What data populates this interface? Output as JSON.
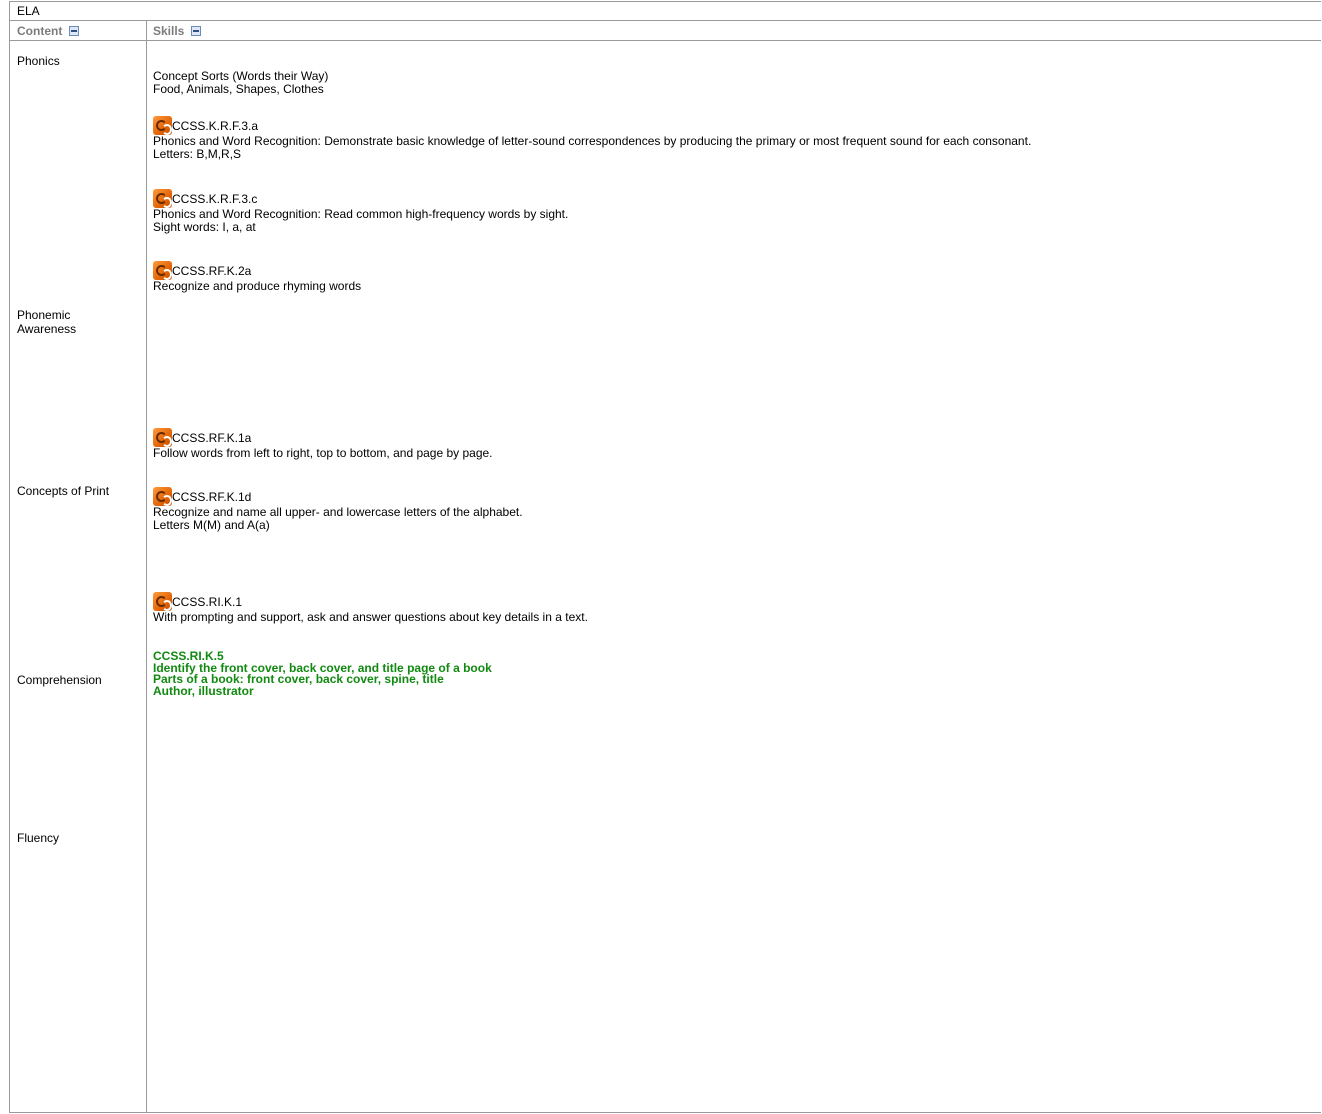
{
  "table": {
    "title": "ELA",
    "headers": {
      "content": "Content",
      "skills": "Skills"
    },
    "content_labels": [
      [
        "Phonics"
      ],
      [
        "Phonemic",
        "Awareness"
      ],
      [
        "Concepts of Print"
      ],
      [
        "Comprehension"
      ],
      [
        "Fluency"
      ]
    ],
    "skills": {
      "concept_sorts": [
        "Concept Sorts (Words their Way)",
        "Food, Animals, Shapes, Clothes"
      ],
      "std1": {
        "code": "CCSS.K.R.F.3.a",
        "lines": [
          "Phonics and Word Recognition: Demonstrate basic knowledge of letter-sound correspondences by producing the primary or most frequent sound for each consonant.",
          "Letters: B,M,R,S"
        ]
      },
      "std2": {
        "code": "CCSS.K.R.F.3.c",
        "lines": [
          "Phonics and Word Recognition: Read common high-frequency words by sight.",
          "Sight words: I, a, at"
        ]
      },
      "std3": {
        "code": "CCSS.RF.K.2a",
        "lines": [
          "Recognize and produce rhyming words"
        ]
      },
      "std4": {
        "code": "CCSS.RF.K.1a",
        "lines": [
          "Follow words from left to right, top to bottom, and page by page."
        ]
      },
      "std5": {
        "code": "CCSS.RF.K.1d",
        "lines": [
          "Recognize and name all upper- and lowercase letters of the alphabet.",
          "Letters M(M) and A(a)"
        ]
      },
      "std6": {
        "code": "CCSS.RI.K.1",
        "lines": [
          "With prompting and support, ask and answer questions about key details in a text."
        ]
      },
      "green": [
        "CCSS.RI.K.5",
        "Identify the front cover, back cover, and title page of a book",
        "Parts of a book: front cover, back cover, spine, title",
        "Author, illustrator"
      ]
    }
  }
}
